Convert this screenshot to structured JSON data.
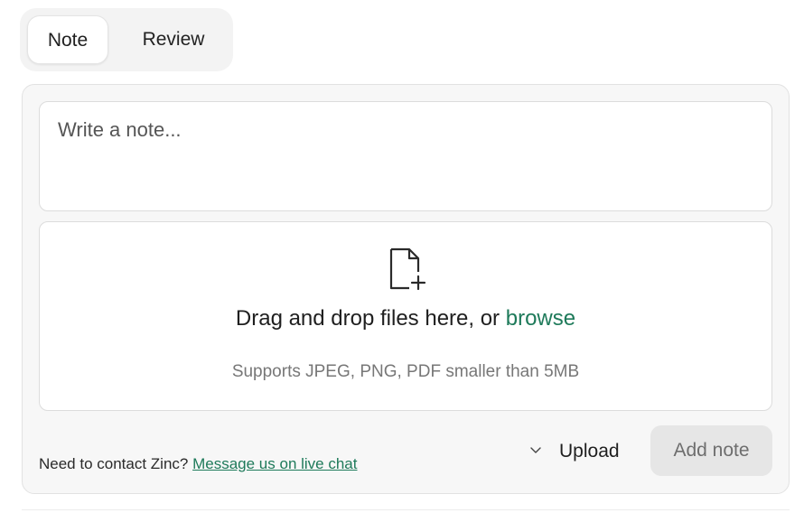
{
  "tabs": {
    "note": "Note",
    "review": "Review"
  },
  "note_input": {
    "placeholder": "Write a note..."
  },
  "dropzone": {
    "icon": "file-plus-icon",
    "text": "Drag and drop files here, or",
    "browse": "browse",
    "hint": "Supports JPEG, PNG, PDF smaller than 5MB"
  },
  "footer": {
    "contact_prefix": "Need to contact Zinc?",
    "chat_link": "Message us on live chat"
  },
  "actions": {
    "upload_icon": "chevron-down-icon",
    "upload_label": "Upload",
    "add_note_label": "Add note"
  },
  "colors": {
    "link": "#1e7a5a",
    "panel_bg": "#f7f7f7",
    "disabled_button_bg": "#e6e6e6"
  }
}
